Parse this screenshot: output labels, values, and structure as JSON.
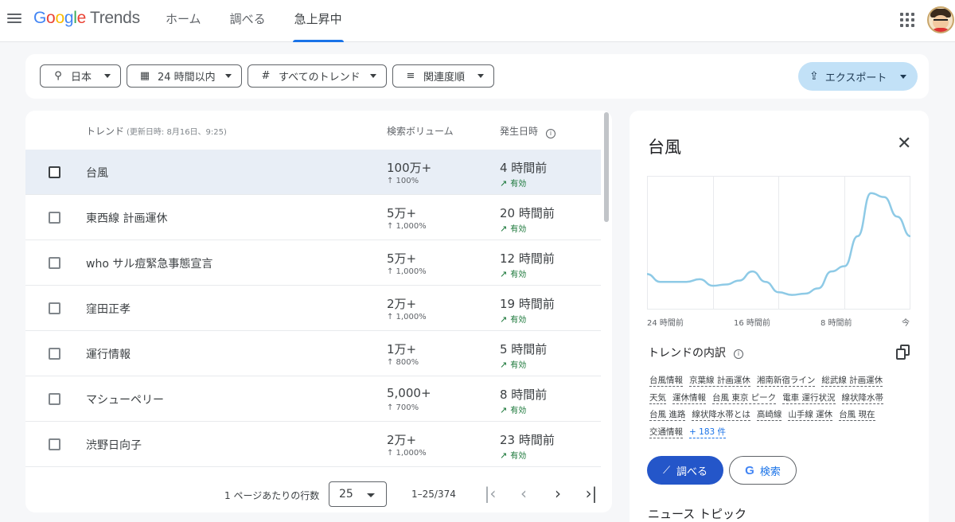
{
  "header": {
    "logo": {
      "google": [
        "G",
        "o",
        "o",
        "g",
        "l",
        "e"
      ],
      "product": "Trends"
    },
    "nav": [
      {
        "label": "ホーム",
        "active": false
      },
      {
        "label": "調べる",
        "active": false
      },
      {
        "label": "急上昇中",
        "active": true
      }
    ]
  },
  "filters": {
    "region": "日本",
    "period": "24 時間以内",
    "category": "すべてのトレンド",
    "sort": "関連度順",
    "export": "エクスポート"
  },
  "table": {
    "headers": {
      "trend": "トレンド",
      "updated": "(更新日時: 8月16日、9:25)",
      "volume": "検索ボリューム",
      "started": "発生日時"
    },
    "rows": [
      {
        "name": "台風",
        "volume": "100万+",
        "change": "↑ 100%",
        "started": "4 時間前",
        "status": "有効",
        "selected": true
      },
      {
        "name": "東西線 計画運休",
        "volume": "5万+",
        "change": "↑ 1,000%",
        "started": "20 時間前",
        "status": "有効",
        "selected": false
      },
      {
        "name": "who サル痘緊急事態宣言",
        "volume": "5万+",
        "change": "↑ 1,000%",
        "started": "12 時間前",
        "status": "有効",
        "selected": false
      },
      {
        "name": "窪田正孝",
        "volume": "2万+",
        "change": "↑ 1,000%",
        "started": "19 時間前",
        "status": "有効",
        "selected": false
      },
      {
        "name": "運行情報",
        "volume": "1万+",
        "change": "↑ 800%",
        "started": "5 時間前",
        "status": "有効",
        "selected": false
      },
      {
        "name": "マシューペリー",
        "volume": "5,000+",
        "change": "↑ 700%",
        "started": "8 時間前",
        "status": "有効",
        "selected": false
      },
      {
        "name": "渋野日向子",
        "volume": "2万+",
        "change": "↑ 1,000%",
        "started": "23 時間前",
        "status": "有効",
        "selected": false
      }
    ],
    "footer": {
      "rows_per_page_label": "1 ページあたりの行数",
      "rows_per_page": "25",
      "range": "1–25/374"
    }
  },
  "detail": {
    "title": "台風",
    "chart_data": {
      "type": "line",
      "x_labels": [
        "24 時間前",
        "16 時間前",
        "8 時間前",
        "今"
      ],
      "values": [
        26,
        20,
        20,
        20,
        22,
        17,
        18,
        21,
        28,
        20,
        12,
        10,
        11,
        15,
        28,
        32,
        55,
        88,
        85,
        70,
        55
      ],
      "y_range": [
        0,
        100
      ],
      "color": "#8ecae6"
    },
    "breakdown_title": "トレンドの内訳",
    "tags": [
      "台風情報",
      "京葉線 計画運休",
      "湘南新宿ライン",
      "総武線 計画運休",
      "天気",
      "運休情報",
      "台風 東京 ピーク",
      "電車 運行状況",
      "線状降水帯",
      "台風 進路",
      "線状降水帯とは",
      "高崎線",
      "山手線 運休",
      "台風 現在",
      "交通情報"
    ],
    "more_tags": "+ 183 件",
    "explore": "調べる",
    "search": "検索",
    "news_title": "ニュース トピック"
  }
}
